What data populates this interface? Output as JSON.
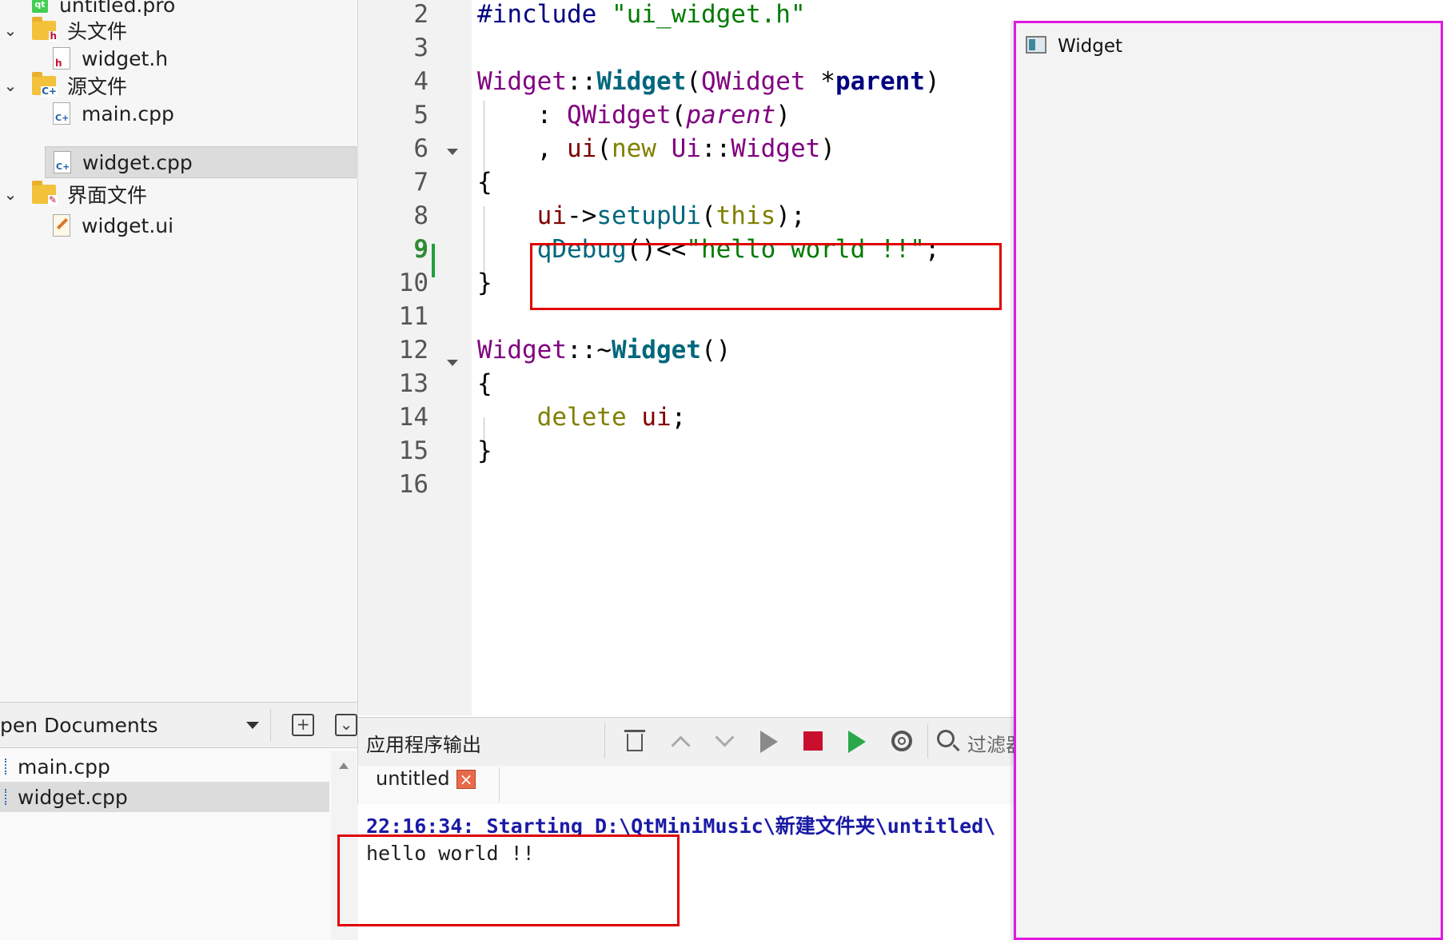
{
  "project_tree": {
    "items": [
      {
        "label": "untitled.pro",
        "kind": "qt-project"
      },
      {
        "label": "头文件",
        "kind": "folder-headers"
      },
      {
        "label": "widget.h",
        "kind": "header-file"
      },
      {
        "label": "源文件",
        "kind": "folder-sources"
      },
      {
        "label": "main.cpp",
        "kind": "cpp-file"
      },
      {
        "label": "widget.cpp",
        "kind": "cpp-file",
        "selected": true
      },
      {
        "label": "界面文件",
        "kind": "folder-forms"
      },
      {
        "label": "widget.ui",
        "kind": "ui-file"
      }
    ]
  },
  "open_documents": {
    "title": "pen Documents",
    "items": [
      {
        "label": "main.cpp"
      },
      {
        "label": "widget.cpp",
        "selected": true
      }
    ]
  },
  "editor": {
    "current_line": "9",
    "line_numbers": [
      "2",
      "3",
      "4",
      "5",
      "6",
      "7",
      "8",
      "9",
      "10",
      "11",
      "12",
      "13",
      "14",
      "15",
      "16"
    ],
    "code": {
      "l2_pp": "#include ",
      "l2_str": "\"ui_widget.h\"",
      "l4_cls": "Widget",
      "l4_sep": "::",
      "l4_fn": "Widget",
      "l4_open": "(",
      "l4_type": "QWidget",
      "l4_star": " *",
      "l4_par": "parent",
      "l4_close": ")",
      "l5_colon": "    : ",
      "l5_cls": "QWidget",
      "l5_open": "(",
      "l5_par": "parent",
      "l5_close": ")",
      "l6_comma": "    , ",
      "l6_mem": "ui",
      "l6_open": "(",
      "l6_kw": "new ",
      "l6_ns": "Ui",
      "l6_sep": "::",
      "l6_cls": "Widget",
      "l6_close": ")",
      "l7": "{",
      "l8_indent": "    ",
      "l8_mem": "ui",
      "l8_arrow": "->",
      "l8_fn": "setupUi",
      "l8_open": "(",
      "l8_kw": "this",
      "l8_close": ");",
      "l9_indent": "    ",
      "l9_fn": "qDebug",
      "l9_ops": "()<<",
      "l9_str": "\"hello world !!\"",
      "l9_end": ";",
      "l10": "}",
      "l12_cls": "Widget",
      "l12_sep": "::~",
      "l12_fn": "Widget",
      "l12_parens": "()",
      "l13": "{",
      "l14_indent": "    ",
      "l14_kw": "delete ",
      "l14_mem": "ui",
      "l14_end": ";",
      "l15": "}"
    }
  },
  "output": {
    "pane_title": "应用程序输出",
    "filter_placeholder": "过滤器",
    "tab_label": "untitled",
    "start_line": "22:16:34: Starting D:\\QtMiniMusic\\新建文件夹\\untitled\\",
    "app_output": "hello world !!"
  },
  "widget_window": {
    "title": "Widget"
  },
  "colors": {
    "highlight_box": "#e00000",
    "window_border": "#e018e0",
    "current_line_number": "#2e8b34"
  },
  "icons": [
    "chevron-down-icon",
    "folder-icon",
    "header-file-icon",
    "cpp-file-icon",
    "ui-file-icon",
    "qt-project-icon",
    "trash-icon",
    "chevron-up-icon",
    "play-icon",
    "stop-icon",
    "debug-run-icon",
    "gear-icon",
    "search-icon",
    "close-icon",
    "window-icon"
  ]
}
